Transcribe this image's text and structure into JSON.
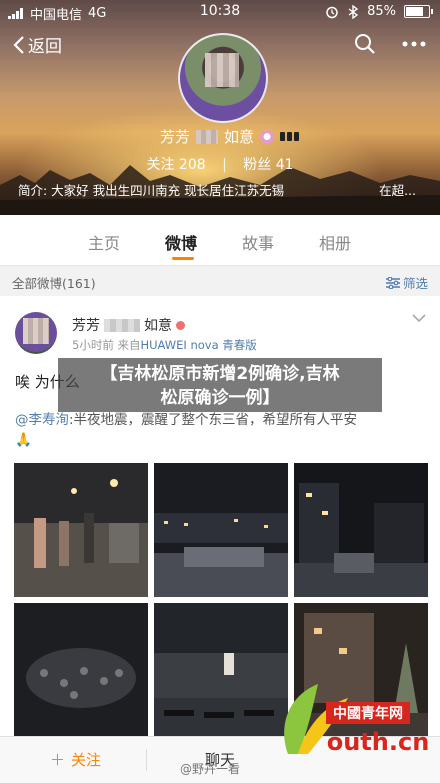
{
  "status": {
    "carrier": "中国电信",
    "network": "4G",
    "time": "10:38",
    "battery": "85%",
    "battery_level": 0.85
  },
  "nav": {
    "back_label": "返回"
  },
  "profile": {
    "name_part1": "芳芳",
    "name_part2": "如意",
    "stats": {
      "following_label": "关注",
      "following_count": "208",
      "fans_label": "粉丝",
      "fans_count": "41"
    },
    "bio": "简介: 大家好  我出生四川南充  现长居住江苏无锡",
    "bio_more": "在超..."
  },
  "tabs": [
    {
      "label": "主页",
      "active": false
    },
    {
      "label": "微博",
      "active": true
    },
    {
      "label": "故事",
      "active": false
    },
    {
      "label": "相册",
      "active": false
    }
  ],
  "filter": {
    "left": "全部微博(161)",
    "right": "筛选"
  },
  "post": {
    "author_part1": "芳芳",
    "author_part2": "如意",
    "time": "5小时前",
    "from": "来自",
    "device": "HUAWEI nova 青春版",
    "text": "唉 为什么",
    "quote_at": "@李寿洵",
    "quote_body": ":半夜地震，震醒了整个东三省，希望所有人平安",
    "quote_emoji": "🙏"
  },
  "overlay": {
    "line1": "【吉林松原市新增2例确诊,吉林",
    "line2": "松原确诊一例】"
  },
  "bottom": {
    "follow": "关注",
    "chat": "聊天"
  },
  "logo": {
    "top": "中國青年网",
    "bottom": "outh.cn"
  },
  "watermark": "@野卉一看"
}
